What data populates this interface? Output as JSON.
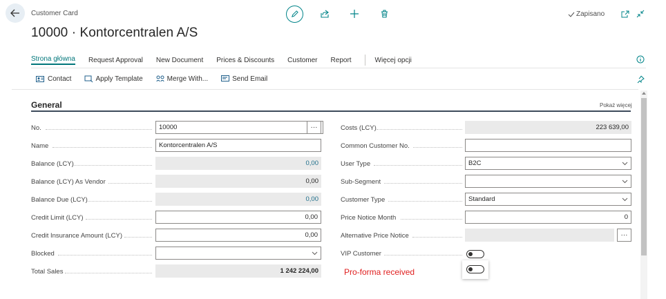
{
  "header": {
    "entity": "Customer Card",
    "title": "10000 · Kontorcentralen A/S",
    "saved_label": "Zapisano"
  },
  "nav": {
    "tabs": [
      {
        "label": "Strona główna"
      },
      {
        "label": "Request Approval"
      },
      {
        "label": "New Document"
      },
      {
        "label": "Prices & Discounts"
      },
      {
        "label": "Customer"
      },
      {
        "label": "Report"
      }
    ],
    "more": "Więcej opcji"
  },
  "actions": [
    {
      "label": "Contact",
      "icon": "contact-icon"
    },
    {
      "label": "Apply Template",
      "icon": "template-icon"
    },
    {
      "label": "Merge With...",
      "icon": "merge-icon"
    },
    {
      "label": "Send Email",
      "icon": "email-icon"
    }
  ],
  "section": {
    "title": "General",
    "show_more": "Pokaż więcej"
  },
  "left_fields": [
    {
      "label": "No.",
      "value": "10000"
    },
    {
      "label": "Name",
      "value": "Kontorcentralen A/S"
    },
    {
      "label": "Balance (LCY)",
      "value": "0,00"
    },
    {
      "label": "Balance (LCY) As Vendor",
      "value": "0,00"
    },
    {
      "label": "Balance Due (LCY)",
      "value": "0,00"
    },
    {
      "label": "Credit Limit (LCY)",
      "value": "0,00"
    },
    {
      "label": "Credit Insurance Amount (LCY)",
      "value": "0,00"
    },
    {
      "label": "Blocked",
      "value": ""
    },
    {
      "label": "Total Sales",
      "value": "1 242 224,00"
    }
  ],
  "right_fields": [
    {
      "label": "Costs (LCY)",
      "value": "223 639,00"
    },
    {
      "label": "Common Customer No.",
      "value": ""
    },
    {
      "label": "User Type",
      "value": "B2C"
    },
    {
      "label": "Sub-Segment",
      "value": ""
    },
    {
      "label": "Customer Type",
      "value": "Standard"
    },
    {
      "label": "Price Notice Month",
      "value": "0"
    },
    {
      "label": "Alternative Price Notice",
      "value": ""
    },
    {
      "label": "VIP Customer",
      "value": ""
    }
  ],
  "annotation": "Pro-forma received",
  "colors": {
    "accent": "#00767a",
    "annotation": "#e02020",
    "readonly_bg": "#eaeaea"
  }
}
